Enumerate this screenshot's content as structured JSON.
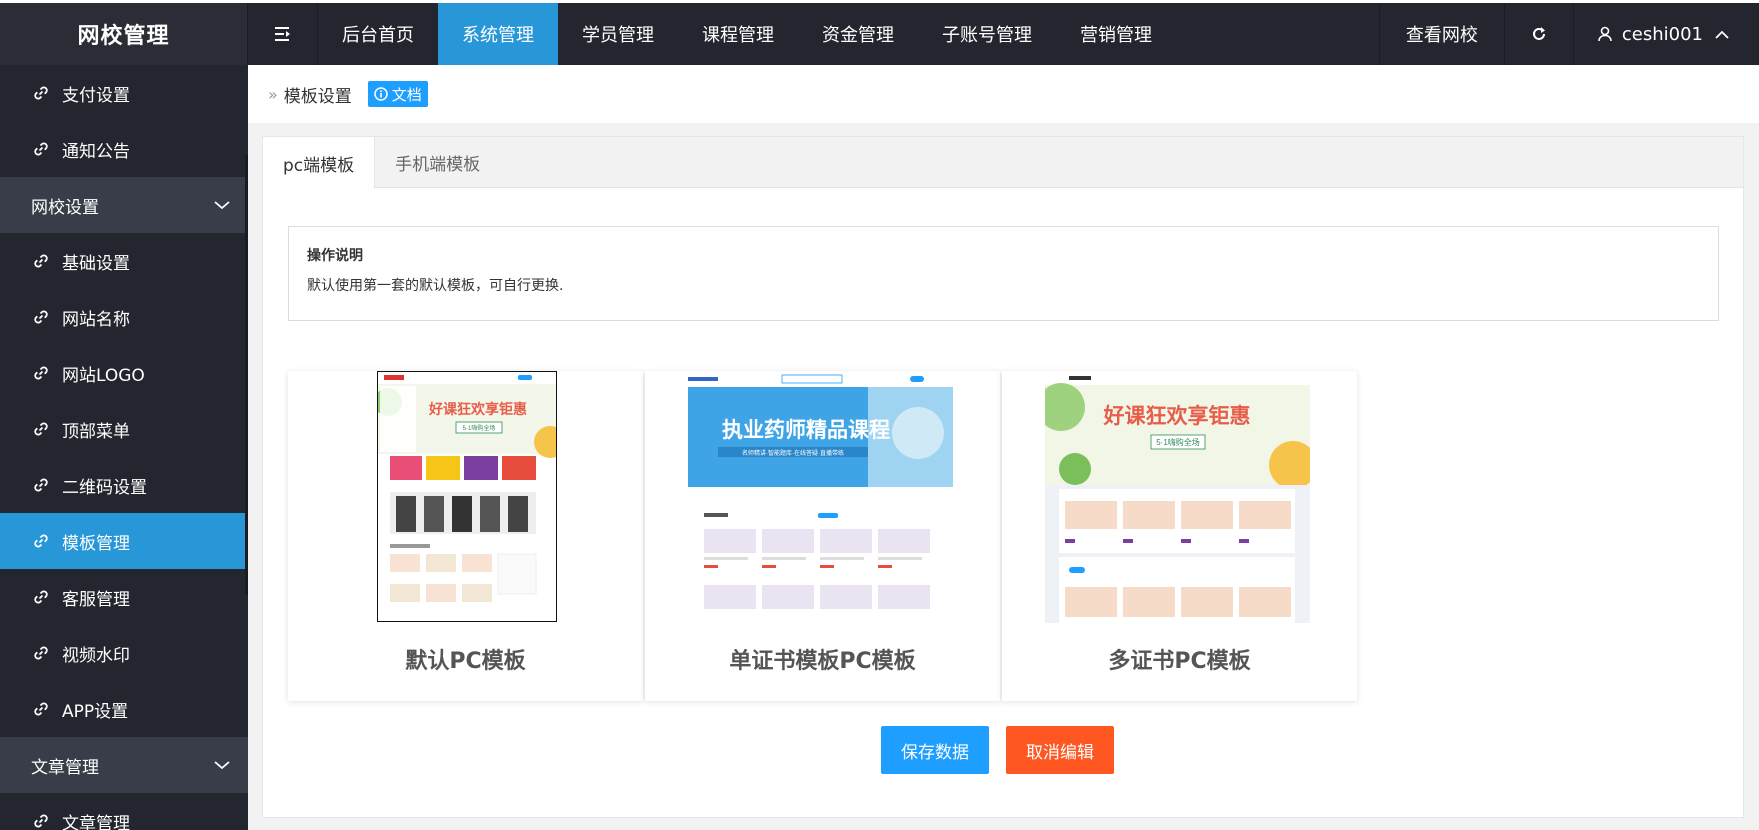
{
  "brand": "网校管理",
  "topnav": {
    "items": [
      "后台首页",
      "系统管理",
      "学员管理",
      "课程管理",
      "资金管理",
      "子账号管理",
      "营销管理"
    ],
    "active_index": 1,
    "view_school": "查看网校",
    "username": "ceshi001"
  },
  "sidebar": {
    "items": [
      {
        "type": "item",
        "label": "支付设置"
      },
      {
        "type": "item",
        "label": "通知公告"
      },
      {
        "type": "group",
        "label": "网校设置"
      },
      {
        "type": "item",
        "label": "基础设置"
      },
      {
        "type": "item",
        "label": "网站名称"
      },
      {
        "type": "item",
        "label": "网站LOGO"
      },
      {
        "type": "item",
        "label": "顶部菜单"
      },
      {
        "type": "item",
        "label": "二维码设置"
      },
      {
        "type": "item",
        "label": "模板管理",
        "active": true
      },
      {
        "type": "item",
        "label": "客服管理"
      },
      {
        "type": "item",
        "label": "视频水印"
      },
      {
        "type": "item",
        "label": "APP设置"
      },
      {
        "type": "group",
        "label": "文章管理"
      },
      {
        "type": "item",
        "label": "文章管理"
      }
    ]
  },
  "breadcrumb": {
    "current": "模板设置",
    "doc_label": "文档"
  },
  "tabs": [
    {
      "label": "pc端模板",
      "active": true
    },
    {
      "label": "手机端模板",
      "active": false
    }
  ],
  "note": {
    "title": "操作说明",
    "text": "默认使用第一套的默认模板，可自行更换."
  },
  "templates": [
    {
      "name": "默认PC模板",
      "selected": true,
      "banner_title": "好课狂欢享钜惠",
      "banner_sub": "5·1嗨购全场"
    },
    {
      "name": "单证书模板PC模板",
      "selected": false,
      "banner_title": "执业药师精品课程",
      "banner_sub": "名师精讲·智能题库·在线答疑·直播带练"
    },
    {
      "name": "多证书PC模板",
      "selected": false,
      "banner_title": "好课狂欢享钜惠",
      "banner_sub": "5·1嗨购全场"
    }
  ],
  "buttons": {
    "save": "保存数据",
    "cancel": "取消编辑"
  },
  "colors": {
    "primary": "#2897d8",
    "button_blue": "#1e9fff",
    "button_orange": "#ff5722",
    "sidebar_bg": "#23262e"
  }
}
